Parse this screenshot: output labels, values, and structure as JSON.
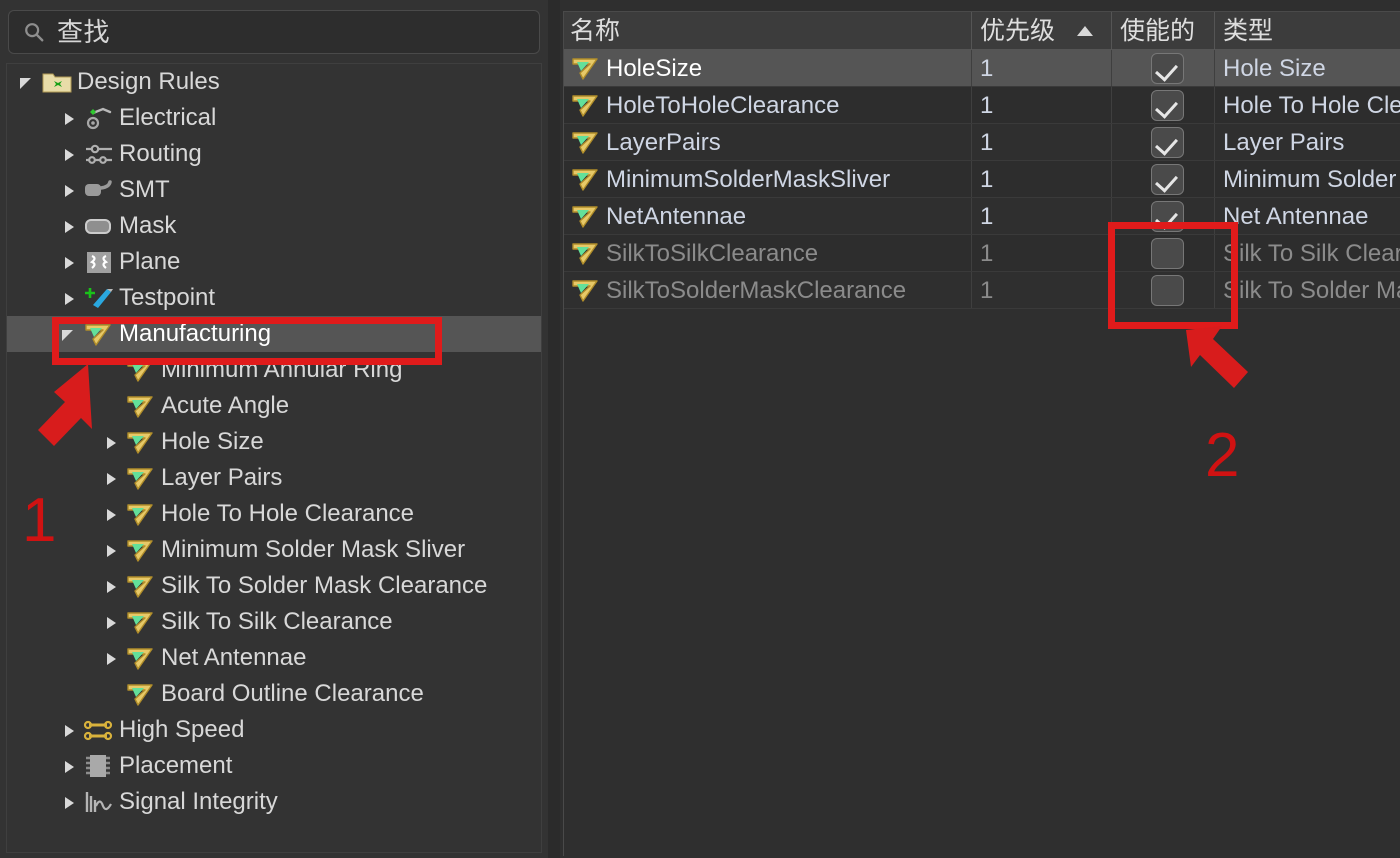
{
  "search": {
    "icon": "search-icon",
    "value": "查找",
    "placeholder": "查找"
  },
  "tree": {
    "items": [
      {
        "label": "Design Rules",
        "depth": 0,
        "icon": "folder-design-rules-icon",
        "expander": "down",
        "selected": false
      },
      {
        "label": "Electrical",
        "depth": 1,
        "icon": "electrical-icon",
        "expander": "right",
        "selected": false
      },
      {
        "label": "Routing",
        "depth": 1,
        "icon": "routing-icon",
        "expander": "right",
        "selected": false
      },
      {
        "label": "SMT",
        "depth": 1,
        "icon": "smt-icon",
        "expander": "right",
        "selected": false
      },
      {
        "label": "Mask",
        "depth": 1,
        "icon": "mask-icon",
        "expander": "right",
        "selected": false
      },
      {
        "label": "Plane",
        "depth": 1,
        "icon": "plane-icon",
        "expander": "right",
        "selected": false
      },
      {
        "label": "Testpoint",
        "depth": 1,
        "icon": "testpoint-icon",
        "expander": "right",
        "selected": false
      },
      {
        "label": "Manufacturing",
        "depth": 1,
        "icon": "rule-icon",
        "expander": "down",
        "selected": true
      },
      {
        "label": "Minimum Annular Ring",
        "depth": 2,
        "icon": "rule-icon",
        "expander": "none",
        "selected": false
      },
      {
        "label": "Acute Angle",
        "depth": 2,
        "icon": "rule-icon",
        "expander": "none",
        "selected": false
      },
      {
        "label": "Hole Size",
        "depth": 2,
        "icon": "rule-icon",
        "expander": "right",
        "selected": false
      },
      {
        "label": "Layer Pairs",
        "depth": 2,
        "icon": "rule-icon",
        "expander": "right",
        "selected": false
      },
      {
        "label": "Hole To Hole Clearance",
        "depth": 2,
        "icon": "rule-icon",
        "expander": "right",
        "selected": false
      },
      {
        "label": "Minimum Solder Mask Sliver",
        "depth": 2,
        "icon": "rule-icon",
        "expander": "right",
        "selected": false
      },
      {
        "label": "Silk To Solder Mask Clearance",
        "depth": 2,
        "icon": "rule-icon",
        "expander": "right",
        "selected": false
      },
      {
        "label": "Silk To Silk Clearance",
        "depth": 2,
        "icon": "rule-icon",
        "expander": "right",
        "selected": false
      },
      {
        "label": "Net Antennae",
        "depth": 2,
        "icon": "rule-icon",
        "expander": "right",
        "selected": false
      },
      {
        "label": "Board Outline Clearance",
        "depth": 2,
        "icon": "rule-icon",
        "expander": "none",
        "selected": false
      },
      {
        "label": "High Speed",
        "depth": 1,
        "icon": "high-speed-icon",
        "expander": "right",
        "selected": false
      },
      {
        "label": "Placement",
        "depth": 1,
        "icon": "placement-icon",
        "expander": "right",
        "selected": false
      },
      {
        "label": "Signal Integrity",
        "depth": 1,
        "icon": "signal-integrity-icon",
        "expander": "right",
        "selected": false
      }
    ]
  },
  "grid": {
    "columns": [
      {
        "key": "name",
        "label": "名称",
        "sorted": false
      },
      {
        "key": "prio",
        "label": "优先级",
        "sorted": true,
        "sort_dir": "asc"
      },
      {
        "key": "enabled",
        "label": "使能的",
        "sorted": false
      },
      {
        "key": "type",
        "label": "类型",
        "sorted": false
      }
    ],
    "rows": [
      {
        "name": "HoleSize",
        "priority": "1",
        "enabled": true,
        "type": "Hole Size",
        "selected": true
      },
      {
        "name": "HoleToHoleClearance",
        "priority": "1",
        "enabled": true,
        "type": "Hole To Hole Clearance",
        "selected": false
      },
      {
        "name": "LayerPairs",
        "priority": "1",
        "enabled": true,
        "type": "Layer Pairs",
        "selected": false
      },
      {
        "name": "MinimumSolderMaskSliver",
        "priority": "1",
        "enabled": true,
        "type": "Minimum Solder Mask Sliver",
        "selected": false
      },
      {
        "name": "NetAntennae",
        "priority": "1",
        "enabled": true,
        "type": "Net Antennae",
        "selected": false
      },
      {
        "name": "SilkToSilkClearance",
        "priority": "1",
        "enabled": false,
        "type": "Silk To Silk Clearance",
        "selected": false
      },
      {
        "name": "SilkToSolderMaskClearance",
        "priority": "1",
        "enabled": false,
        "type": "Silk To Solder Mask Clearance",
        "selected": false
      }
    ]
  },
  "annotations": {
    "marker_color": "#e01b1b",
    "items": [
      {
        "label": "1",
        "target": "sidebar-item-manufacturing"
      },
      {
        "label": "2",
        "target": "enabled-checkbox-column"
      }
    ]
  }
}
